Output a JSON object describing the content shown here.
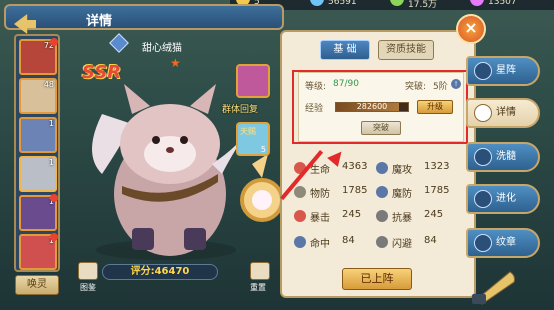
{
  "header": {
    "title": "详情",
    "back_icon": "back-arrow-icon"
  },
  "currency": [
    {
      "icon": "coin-icon",
      "color": "#f2c94c",
      "value": "5"
    },
    {
      "icon": "gem-icon",
      "color": "#6fc3f7",
      "value": "56591"
    },
    {
      "icon": "energy-icon",
      "color": "#8bd65a",
      "value": "17.5万"
    },
    {
      "icon": "ticket-icon",
      "color": "#e879f9",
      "value": "13507"
    }
  ],
  "roster": {
    "slots": [
      {
        "level": "72",
        "color": "#b6463a",
        "badge": true
      },
      {
        "level": "48",
        "color": "#d7c09a",
        "badge": false
      },
      {
        "level": "1",
        "color": "#6b84b5",
        "badge": false
      },
      {
        "level": "1",
        "color": "#b9bec7",
        "badge": false
      },
      {
        "level": "1",
        "color": "#6a4b8d",
        "badge": true
      },
      {
        "level": "1",
        "color": "#d05050",
        "badge": true
      }
    ],
    "zoom_label": "唤灵"
  },
  "pet": {
    "name": "甜心绒猫",
    "rarity": "SSR",
    "score": "评分:46470",
    "skill_1_label": "群体回复",
    "skill_2_label": "天赐",
    "skill_2_badge": "5",
    "left_button_label": "图鉴",
    "right_button_label": "重置"
  },
  "panel": {
    "tabs": [
      {
        "label": "基 础",
        "active": true
      },
      {
        "label": "资质技能",
        "active": false
      }
    ],
    "level_label": "等级:",
    "level_value": "87/90",
    "break_label": "突破:",
    "break_value": "5阶",
    "info_icon": "!",
    "exp_label": "经验",
    "exp_value": "282600",
    "exp_fraction": 0.88,
    "upgrade_label": "升级",
    "breakthrough_label": "突破",
    "stats": [
      {
        "label": "生命",
        "value": "4363",
        "color": "#d9574a"
      },
      {
        "label": "魔攻",
        "value": "1323",
        "color": "#5b77a8"
      },
      {
        "label": "物防",
        "value": "1785",
        "color": "#8e8a7a"
      },
      {
        "label": "魔防",
        "value": "1785",
        "color": "#5b77a8"
      },
      {
        "label": "暴击",
        "value": "245",
        "color": "#d9574a"
      },
      {
        "label": "抗暴",
        "value": "245",
        "color": "#7a7a7a"
      },
      {
        "label": "命中",
        "value": "84",
        "color": "#5b77a8"
      },
      {
        "label": "闪避",
        "value": "84",
        "color": "#7a7a7a"
      }
    ],
    "deploy_label": "已上阵"
  },
  "side_tabs": [
    {
      "label": "星阵",
      "active": false
    },
    {
      "label": "详情",
      "active": true
    },
    {
      "label": "洗髓",
      "active": false
    },
    {
      "label": "进化",
      "active": false
    },
    {
      "label": "纹章",
      "active": false
    }
  ],
  "close_label": "×"
}
